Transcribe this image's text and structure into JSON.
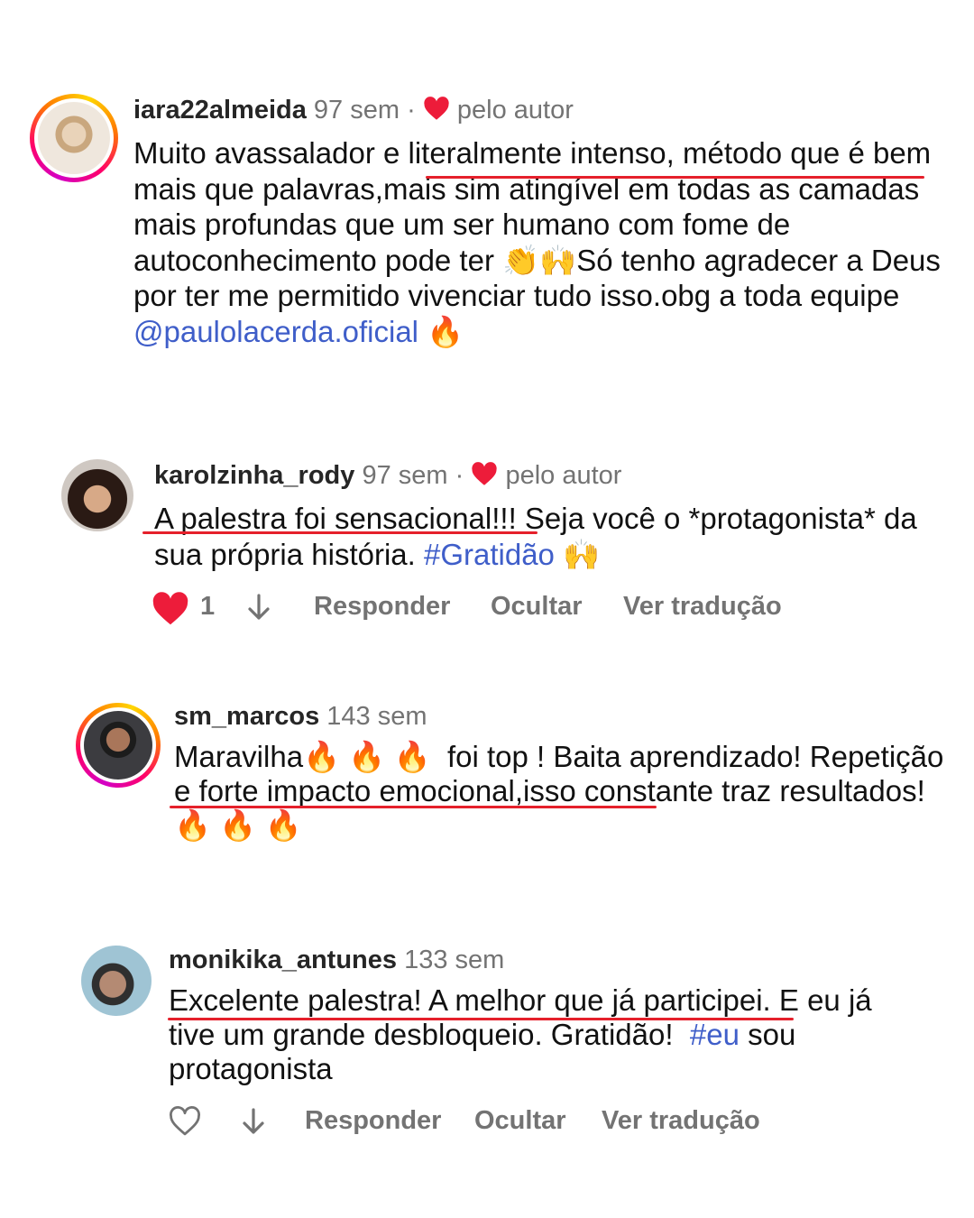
{
  "comments": [
    {
      "username": "iara22almeida",
      "time": "97 sem",
      "separator": "·",
      "liked_by_author": "pelo autor",
      "text_parts": [
        "Muito avassalador e literalmente intenso, método que é bem mais que palavras,mais sim atingível em todas as camadas mais profundas que um ser humano com fome de autoconhecimento pode ter 👏🙌Só tenho agradecer a Deus por ter me permitido vivenciar tudo isso.obg a toda equipe ",
        "@paulolacerda.oficial",
        " 🔥"
      ]
    },
    {
      "username": "karolzinha_rody",
      "time": "97 sem",
      "separator": "·",
      "liked_by_author": "pelo autor",
      "text_parts": [
        "A palestra foi sensacional!!! Seja você o *protagonista* da sua própria história. ",
        "#Gratidão",
        " 🙌"
      ],
      "actions": {
        "like_count": "1",
        "reply": "Responder",
        "hide": "Ocultar",
        "translate": "Ver tradução"
      }
    },
    {
      "username": "sm_marcos",
      "time": "143 sem",
      "text_parts": [
        "Maravilha🔥 🔥 🔥  foi top ! Baita aprendizado! Repetição e forte impacto emocional,isso constante traz resultados! 🔥 🔥 🔥"
      ]
    },
    {
      "username": "monikika_antunes",
      "time": "133 sem",
      "text_parts": [
        "Excelente palestra! A melhor que já participei. E eu já tive um grande desbloqueio. Gratidão!  ",
        "#eu",
        " sou protagonista"
      ],
      "actions": {
        "reply": "Responder",
        "hide": "Ocultar",
        "translate": "Ver tradução"
      }
    }
  ],
  "colors": {
    "underline": "#e5202b",
    "link": "#3f5ec9",
    "heart": "#ed1c3a"
  },
  "icons": [
    "heart-icon",
    "arrow-down-icon",
    "heart-outline-icon"
  ]
}
